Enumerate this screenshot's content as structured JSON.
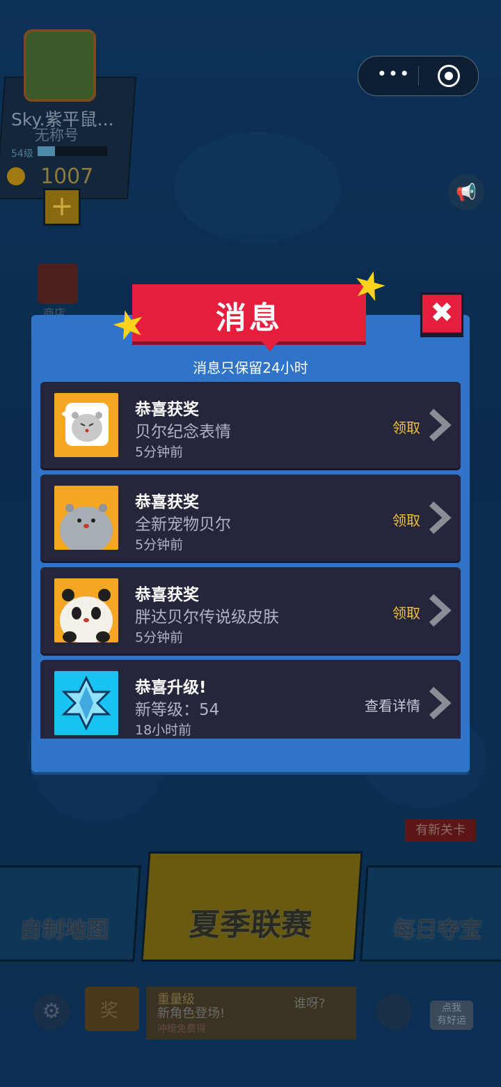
{
  "player": {
    "name": "Sky.紫平鼠...",
    "title": "无称号",
    "level": "54级",
    "xp_fraction": 0.25,
    "coins": "1007"
  },
  "shop": {
    "label": "商店"
  },
  "dialog": {
    "title": "消息",
    "subtitle": "消息只保留24小时",
    "close_symbol": "✖",
    "messages": [
      {
        "title": "恭喜获奖",
        "desc": "贝尔纪念表情",
        "time": "5分钟前",
        "action": "领取",
        "thumb": "seal-sticker",
        "thumb_color": "#f5a623"
      },
      {
        "title": "恭喜获奖",
        "desc": "全新宠物贝尔",
        "time": "5分钟前",
        "action": "领取",
        "thumb": "seal-pet",
        "thumb_color": "#f5a623"
      },
      {
        "title": "恭喜获奖",
        "desc": "胖达贝尔传说级皮肤",
        "time": "5分钟前",
        "action": "领取",
        "thumb": "panda-skin",
        "thumb_color": "#f5a623"
      },
      {
        "title": "恭喜升级!",
        "desc": "新等级：54",
        "time": "18小时前",
        "action": "查看详情",
        "thumb": "star-crystal",
        "thumb_color": "#18c3f0"
      }
    ]
  },
  "modes": {
    "left": "自制地图",
    "center": "夏季联赛",
    "right": "每日夺宝",
    "new_badge": "有新关卡"
  },
  "bottom": {
    "prize_label": "奖",
    "banner_line1": "重量级",
    "banner_line2": "新角色登场!",
    "banner_line3": "冲榜免费得",
    "banner_bubble": "谁呀?",
    "luck_label": "点我\n有好运"
  },
  "colors": {
    "dialog_bg": "#2f74c9",
    "banner_red": "#e41e3c",
    "row_bg": "#25253c",
    "claim_gold": "#f1c233"
  }
}
